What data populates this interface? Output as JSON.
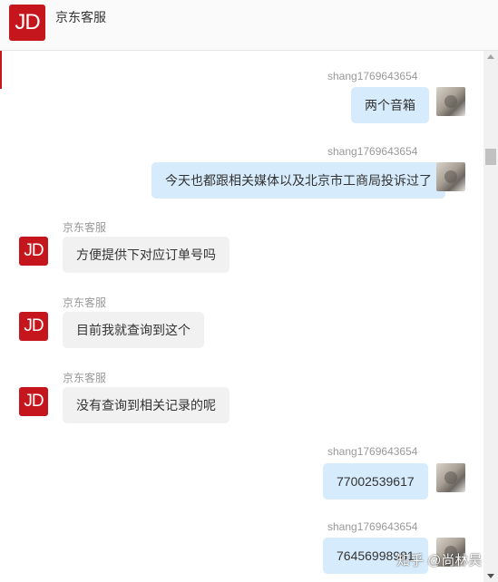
{
  "header": {
    "logo_text": "JD",
    "title": "京东客服"
  },
  "messages": [
    {
      "sender": "shang1769643654",
      "text": "两个音箱"
    },
    {
      "sender": "shang1769643654",
      "text": "今天也都跟相关媒体以及北京市工商局投诉过了"
    },
    {
      "sender": "京东客服",
      "text": "方便提供下对应订单号吗"
    },
    {
      "sender": "京东客服",
      "text": "目前我就查询到这个"
    },
    {
      "sender": "京东客服",
      "text": "没有查询到相关记录的呢"
    },
    {
      "sender": "shang1769643654",
      "text": "77002539617"
    },
    {
      "sender": "shang1769643654",
      "text": "76456998981"
    }
  ],
  "watermark": "知乎 @尚林昊",
  "colors": {
    "brand_red": "#c5161d",
    "outgoing_bubble": "#d6ebfb",
    "incoming_bubble": "#f1f1f1"
  }
}
